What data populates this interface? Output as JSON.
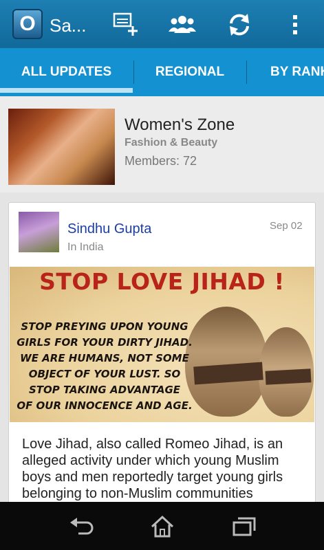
{
  "actionbar": {
    "app_title": "Sa...",
    "logo_letter": "O",
    "icons": [
      "create-group-icon",
      "people-icon",
      "refresh-icon",
      "overflow-menu-icon"
    ]
  },
  "tabs": [
    {
      "label": "ALL UPDATES",
      "selected": true
    },
    {
      "label": "REGIONAL",
      "selected": false
    },
    {
      "label": "BY RANK",
      "selected": false
    }
  ],
  "group": {
    "name": "Women's Zone",
    "category": "Fashion & Beauty",
    "members": "Members: 72"
  },
  "post": {
    "author": "Sindhu Gupta",
    "location": "In India",
    "date": "Sep 02",
    "image_headline": "STOP LOVE JIHAD !",
    "image_lines": [
      "STOP PREYING UPON YOUNG",
      "GIRLS FOR YOUR DIRTY JIHAD.",
      "WE ARE HUMANS, NOT SOME",
      "OBJECT OF YOUR LUST. SO",
      "STOP TAKING ADVANTAGE",
      "OF OUR INNOCENCE AND AGE."
    ],
    "text": "Love Jihad, also called Romeo Jihad, is an alleged activity under which young Muslim boys and men reportedly target young girls belonging to non-Muslim communities"
  },
  "navbar": {
    "icons": [
      "back-icon",
      "home-icon",
      "recent-apps-icon"
    ]
  },
  "colors": {
    "actionbar": "#12699a",
    "tabs": "#1391d1",
    "author_link": "#1a3da8",
    "headline_red": "#b8231a"
  }
}
